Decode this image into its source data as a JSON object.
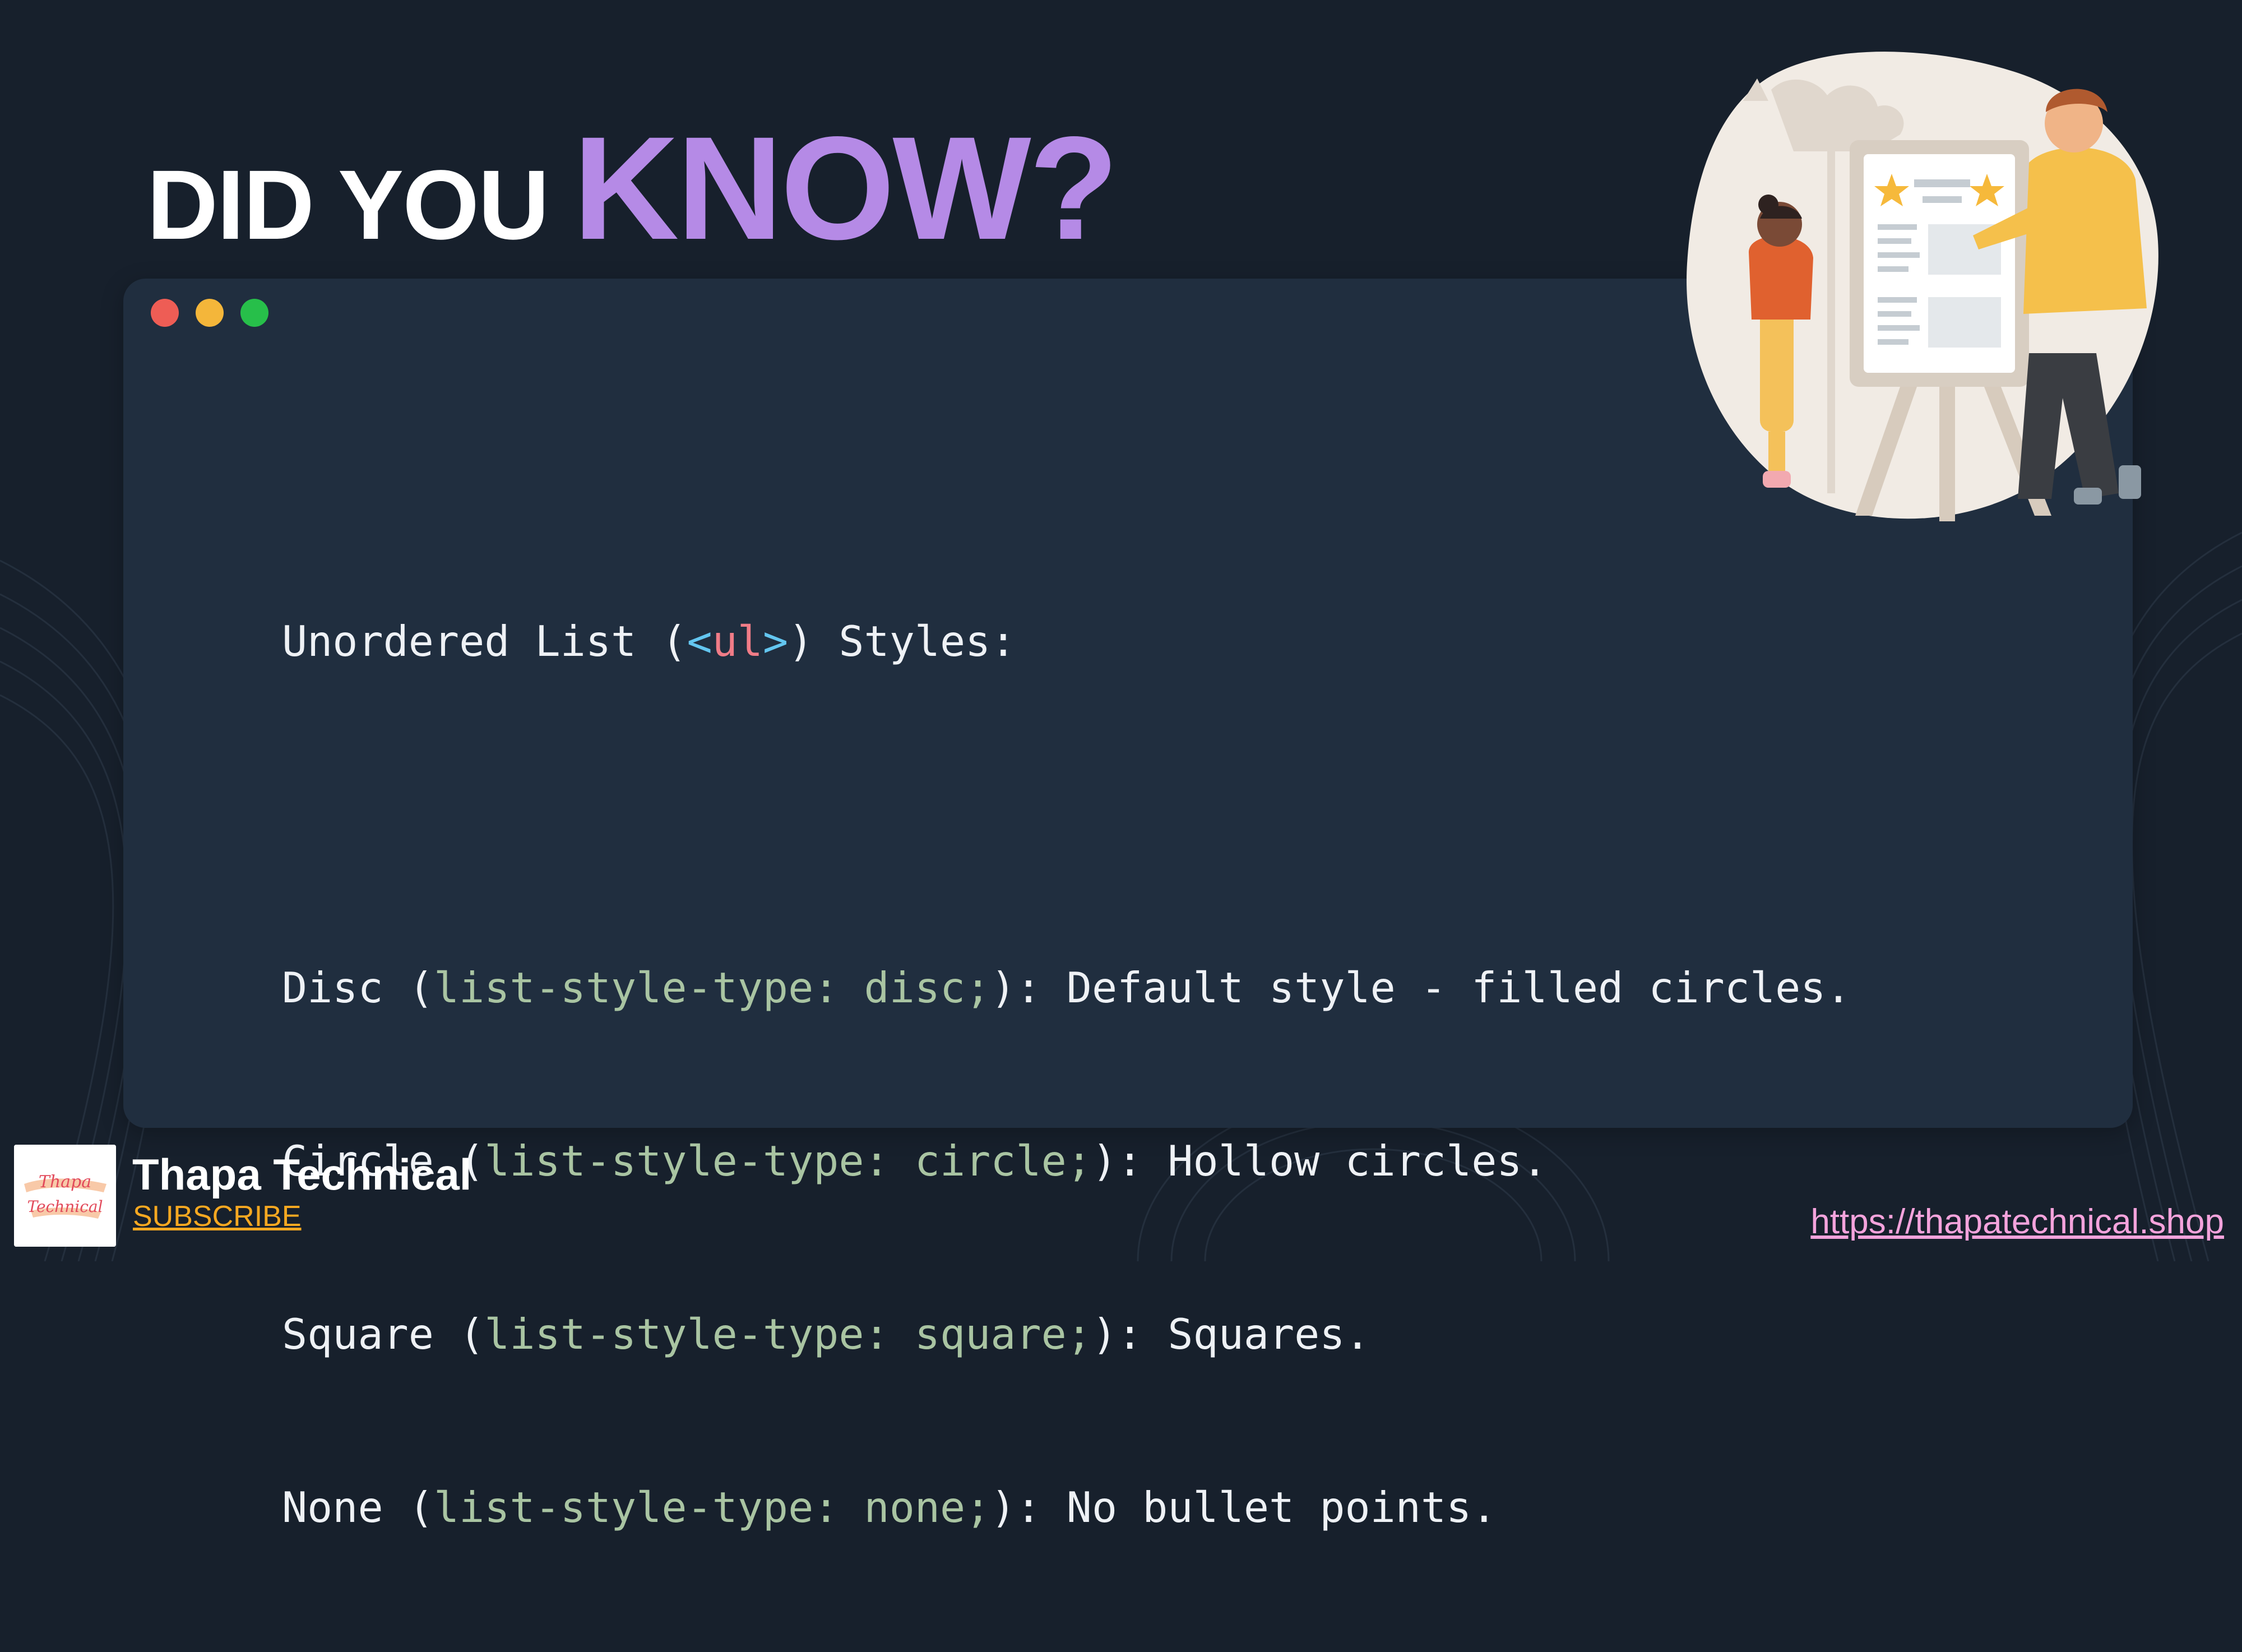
{
  "headline": {
    "part1": "DID YOU",
    "part2": "KNOW?"
  },
  "code_window": {
    "title_line": {
      "prefix": "Unordered List (",
      "open_bracket": "<",
      "tag": "ul",
      "close_bracket": ">",
      "suffix": ") Styles:"
    },
    "items": [
      {
        "name": "Disc (",
        "property": "list-style-type: disc;",
        "description": "): Default style - filled circles."
      },
      {
        "name": "Circle (",
        "property": "list-style-type: circle;",
        "description": "): Hollow circles."
      },
      {
        "name": "Square (",
        "property": "list-style-type: square;",
        "description": "): Squares."
      },
      {
        "name": "None (",
        "property": "list-style-type: none;",
        "description": "): No bullet points."
      }
    ]
  },
  "footer": {
    "brand_name": "Thapa Technical",
    "subscribe_label": "SUBSCRIBE",
    "website": "https://thapatechnical.shop",
    "logo_text": [
      "Thapa",
      "Technical"
    ]
  },
  "colors": {
    "background": "#17202c",
    "panel": "#202e3f",
    "accent_purple": "#b58ae6",
    "property_green": "#a9c4a2",
    "tag_red": "#f07c87",
    "bracket_blue": "#63c6f0",
    "subscribe_orange": "#f6a821",
    "link_pink": "#f4a3dc"
  },
  "icons": {
    "window_controls": [
      "close-dot-icon",
      "minimize-dot-icon",
      "maximize-dot-icon"
    ],
    "illustration": "teacher-and-student-illustration"
  }
}
